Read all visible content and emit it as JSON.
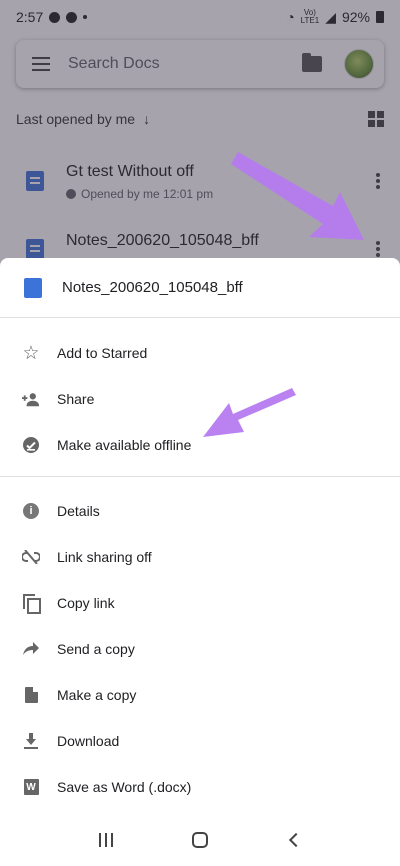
{
  "status_bar": {
    "time": "2:57",
    "network_label_top": "Vo)",
    "network_label_bottom": "LTE1",
    "battery": "92%"
  },
  "search": {
    "placeholder": "Search Docs"
  },
  "list": {
    "sort_label": "Last opened by me",
    "sort_arrow": "↓",
    "files": [
      {
        "title": "Gt test Without off",
        "subtitle": "Opened by me 12:01 pm"
      },
      {
        "title": "Notes_200620_105048_bff"
      }
    ]
  },
  "sheet": {
    "file_name": "Notes_200620_105048_bff",
    "group1": [
      {
        "label": "Add to Starred",
        "icon": "star-icon"
      },
      {
        "label": "Share",
        "icon": "add-person-icon"
      },
      {
        "label": "Make available offline",
        "icon": "offline-check-icon"
      }
    ],
    "group2": [
      {
        "label": "Details",
        "icon": "info-icon"
      },
      {
        "label": "Link sharing off",
        "icon": "link-off-icon"
      },
      {
        "label": "Copy link",
        "icon": "copy-icon"
      },
      {
        "label": "Send a copy",
        "icon": "forward-icon"
      },
      {
        "label": "Make a copy",
        "icon": "file-copy-icon"
      },
      {
        "label": "Download",
        "icon": "download-icon"
      },
      {
        "label": "Save as Word (.docx)",
        "icon": "word-icon"
      }
    ]
  },
  "icon_glyphs": {
    "info": "i",
    "word": "W",
    "star": "☆",
    "forward": "➦",
    "link_off": "⊘"
  },
  "colors": {
    "doc_blue": "#3c73d9",
    "annotation_arrow": "#b57bef",
    "scrim": "#7a6f86"
  }
}
